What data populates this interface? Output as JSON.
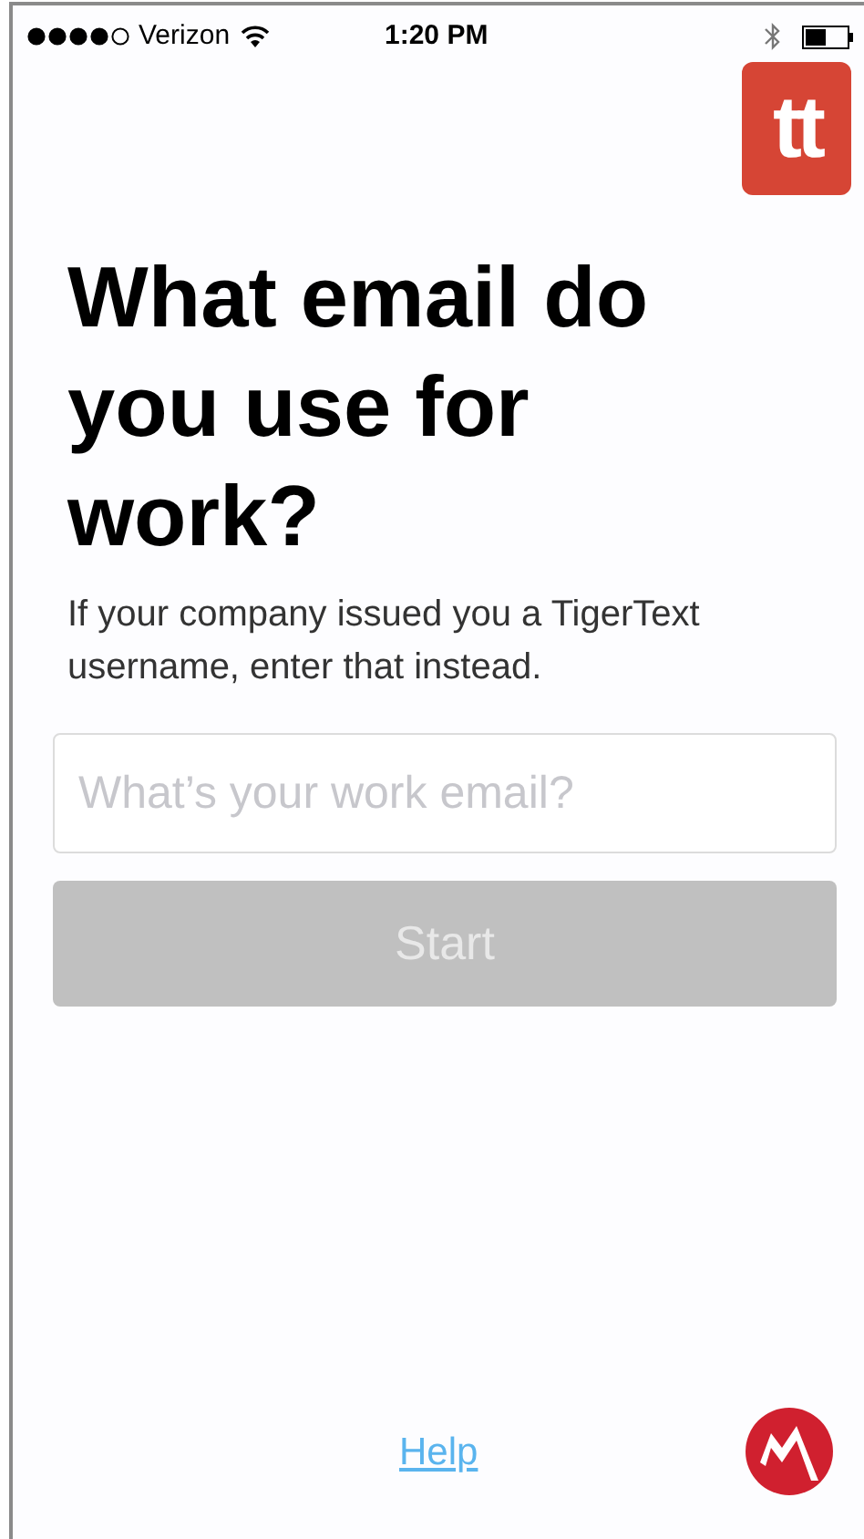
{
  "status_bar": {
    "carrier": "Verizon",
    "time": "1:20 PM"
  },
  "app_logo": {
    "text": "tt"
  },
  "title": "What email do you use for work?",
  "subtitle": "If your company issued you a TigerText username, enter that instead.",
  "email_field": {
    "placeholder": "What’s your work email?"
  },
  "start_button": {
    "label": "Start",
    "disabled": true
  },
  "help_link": "Help"
}
